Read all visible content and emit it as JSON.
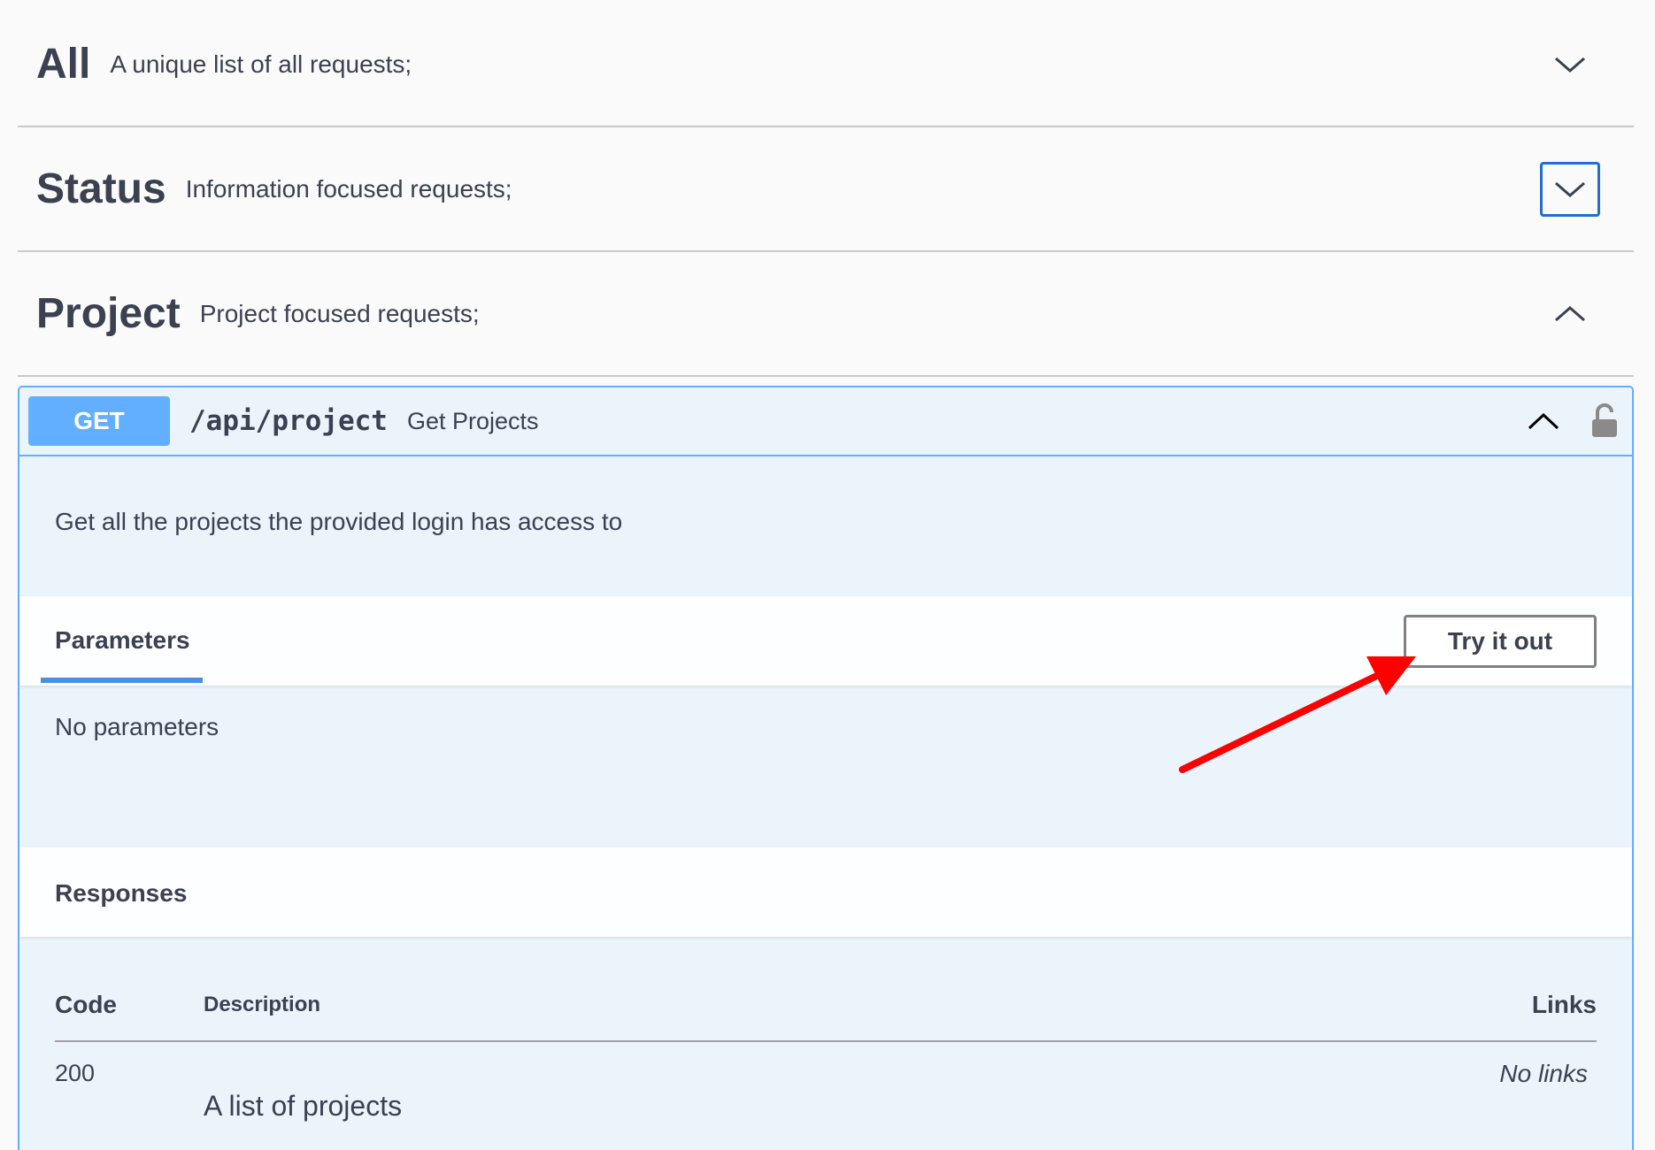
{
  "tags": [
    {
      "name": "All",
      "description": "A unique list of all requests;",
      "expanded": false
    },
    {
      "name": "Status",
      "description": "Information focused requests;",
      "expanded": false
    },
    {
      "name": "Project",
      "description": "Project focused requests;",
      "expanded": true
    }
  ],
  "operation": {
    "method": "GET",
    "path": "/api/project",
    "summary": "Get Projects",
    "description": "Get all the projects the provided login has access to",
    "method_color": "#61affe",
    "icons": {
      "collapse": "chevron-up-icon",
      "lock": "lock-icon"
    }
  },
  "parameters": {
    "tab_label": "Parameters",
    "try_button": "Try it out",
    "empty_text": "No parameters"
  },
  "responses": {
    "title": "Responses",
    "columns": {
      "code": "Code",
      "description": "Description",
      "links": "Links"
    },
    "rows": [
      {
        "code": "200",
        "description": "A list of projects",
        "links": "No links"
      }
    ]
  },
  "annotation": {
    "color": "#ff0000",
    "type": "arrow"
  }
}
